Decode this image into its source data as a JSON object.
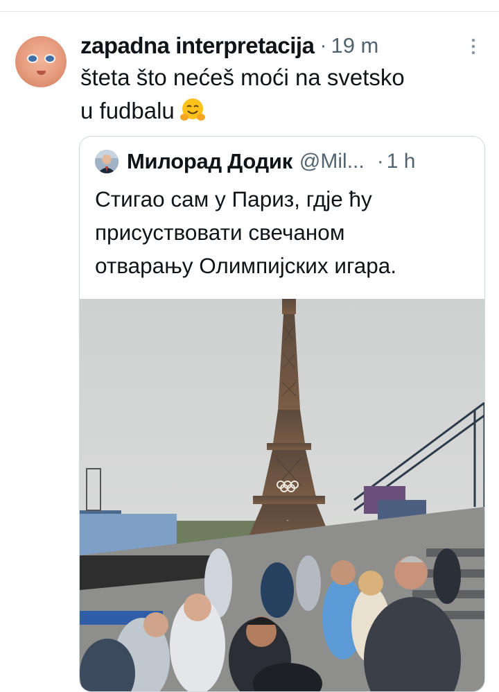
{
  "tweet": {
    "author_name": "zapadna interpretacija",
    "separator": "·",
    "time": "19 m",
    "text_line1": "šteta što nećeš moći na svetsko",
    "text_line2": "u fudbalu",
    "emoji": "hugging-face-emoji"
  },
  "quote": {
    "author_name": "Милорад Додик",
    "handle": "@Mil...",
    "separator": "·",
    "time": "1 h",
    "text_line1": "Стигао сам у Париз, гдје ћу",
    "text_line2": "присуствовати свечаном",
    "text_line3": "отварању Олимпијских игара."
  },
  "colors": {
    "text": "#0f1419",
    "secondary_text": "#536471",
    "border": "#cfd9de",
    "sky": "#d2d4d4"
  },
  "icons": [
    "more-vertical-icon",
    "hugging-face-emoji"
  ]
}
